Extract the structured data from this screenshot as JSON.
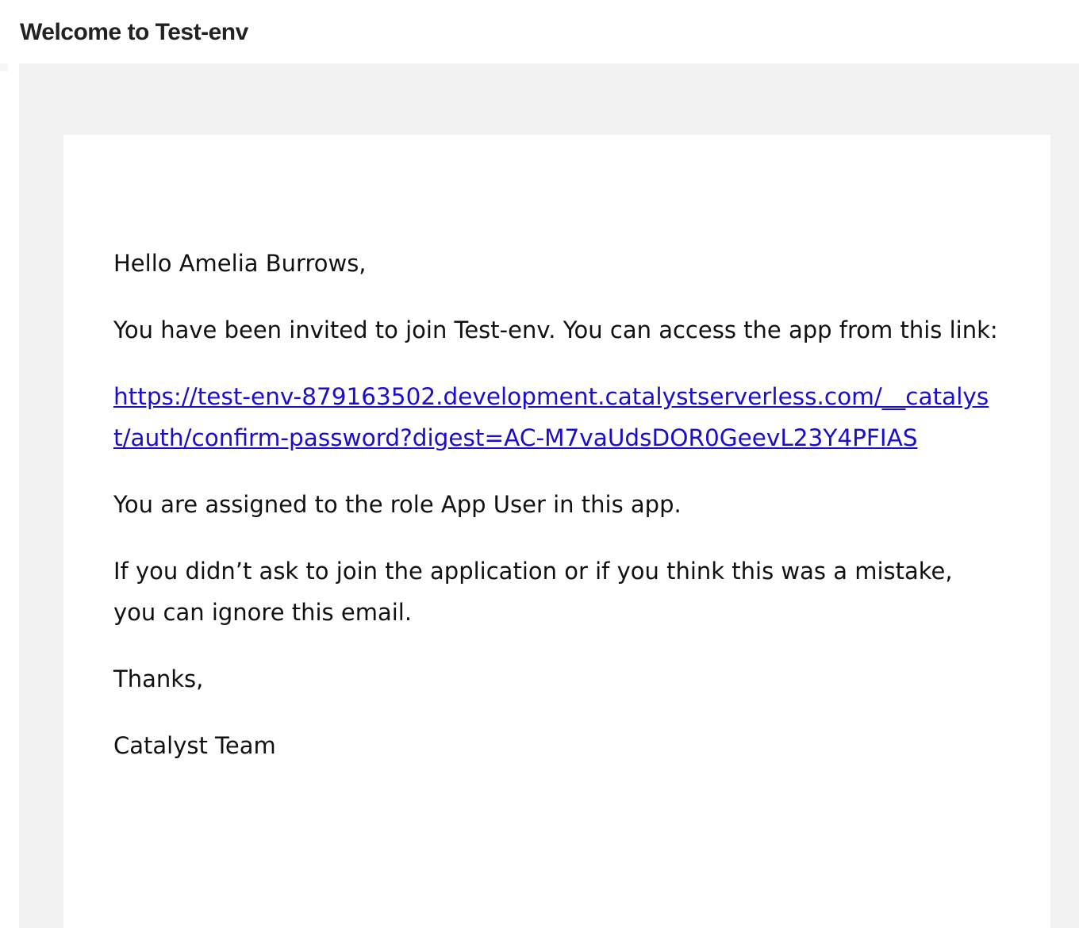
{
  "header": {
    "title": "Welcome to Test-env"
  },
  "email": {
    "greeting": "Hello Amelia Burrows,",
    "invite_text": "You have been invited to join Test-env. You can access the app from this link:",
    "invite_link": "https://test-env-879163502.development.catalystserverless.com/__catalyst/auth/confirm-password?digest=AC-M7vaUdsDOR0GeevL23Y4PFIAS",
    "role_text": "You are assigned to the role App User in this app.",
    "ignore_text": "If you didn’t ask to join the application or if you think this was a mistake, you can ignore this email.",
    "thanks": "Thanks,",
    "signature": "Catalyst Team"
  },
  "colors": {
    "link": "#1a0dcc",
    "outer_background": "#f2f2f2",
    "card_background": "#ffffff"
  }
}
